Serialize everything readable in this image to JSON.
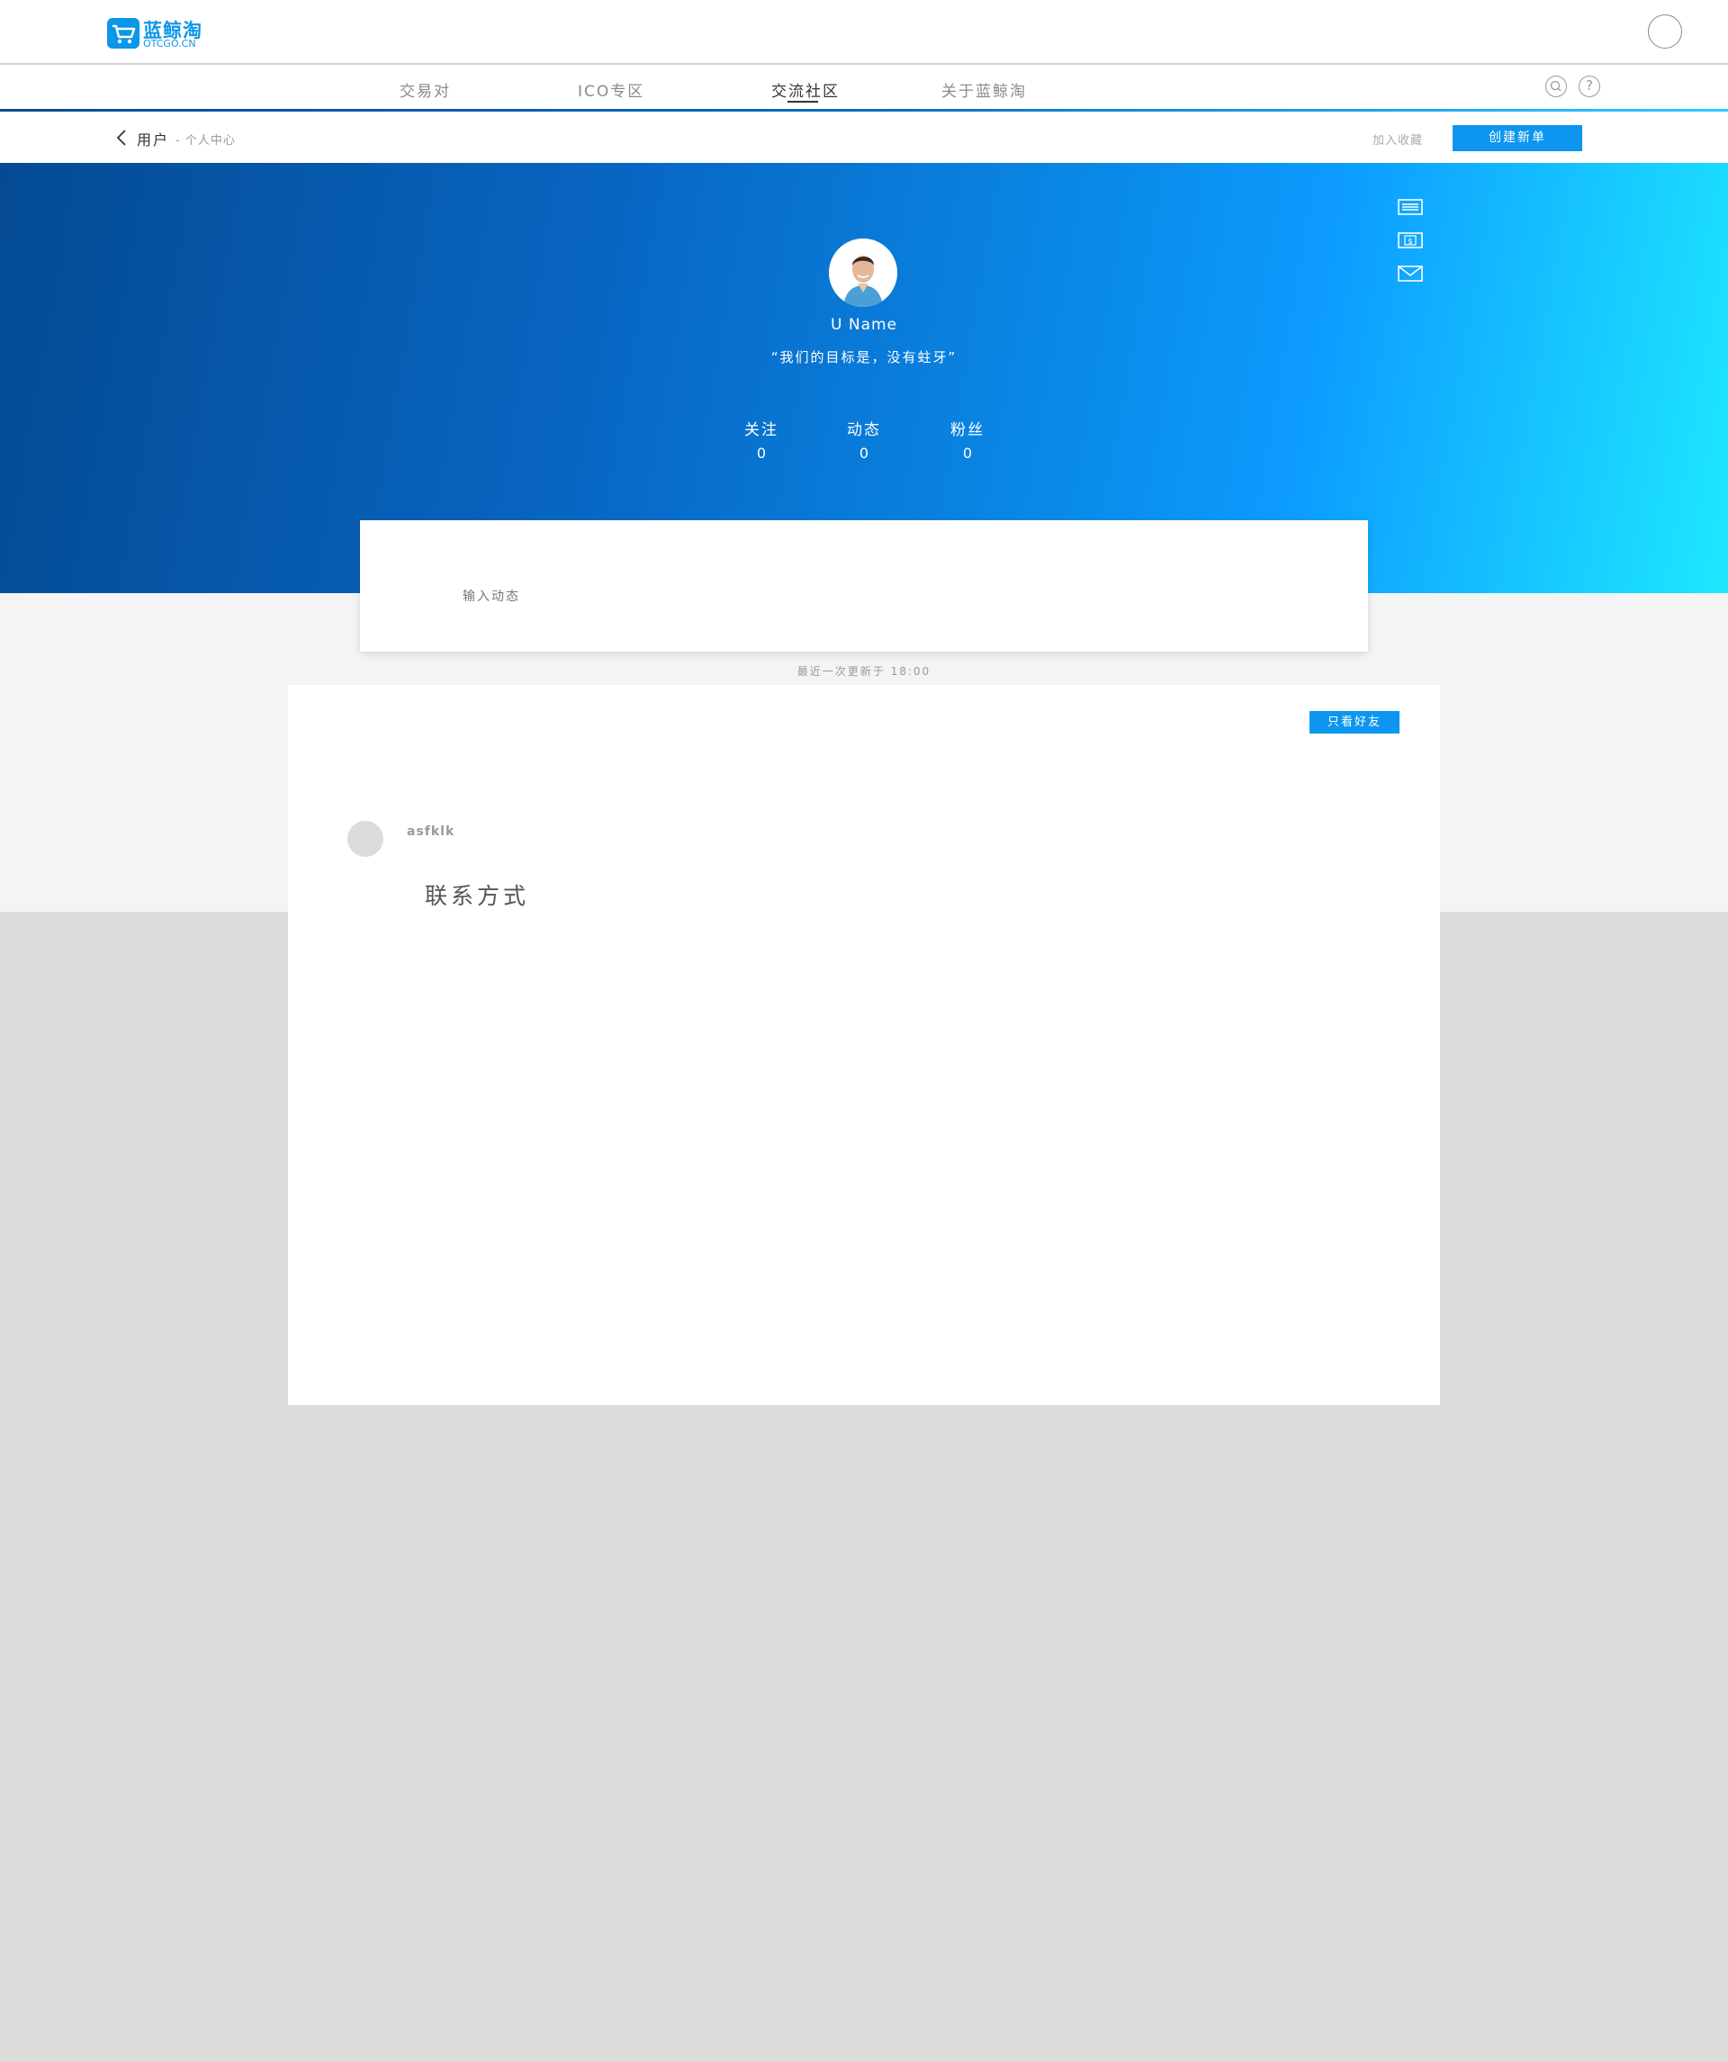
{
  "header": {
    "logo_cn": "蓝鲸淘",
    "logo_en": "OTCGO.CN",
    "logo_icon": "shopping-cart-icon",
    "user_icon": "user-avatar-circle"
  },
  "nav": {
    "items": [
      {
        "label": "交易对",
        "active": false
      },
      {
        "label": "ICO专区",
        "active": false
      },
      {
        "label": "交流社区",
        "active": true
      },
      {
        "label": "关于蓝鲸淘",
        "active": false
      }
    ],
    "help_glyph": "?",
    "icons": [
      "search-icon",
      "help-icon"
    ]
  },
  "breadcrumb": {
    "title": "用户",
    "subtitle": "- 个人中心",
    "favorite_label": "加入收藏",
    "create_label": "创建新单",
    "back_icon": "chevron-left-icon"
  },
  "profile": {
    "username": "U Name",
    "motto": "“我们的目标是，没有蛀牙”",
    "stats": [
      {
        "label": "关注",
        "value": "0"
      },
      {
        "label": "动态",
        "value": "0"
      },
      {
        "label": "粉丝",
        "value": "0"
      }
    ],
    "side_icons": [
      "list-icon",
      "dollar-bill-icon",
      "mail-icon"
    ]
  },
  "composer": {
    "placeholder": "输入动态",
    "last_update": "最近一次更新于 18:00"
  },
  "feed": {
    "filter_label": "只看好友",
    "posts": [
      {
        "author": "asfklk",
        "content": "联系方式"
      }
    ]
  },
  "colors": {
    "accent": "#0c96f0",
    "banner_start": "#044a93",
    "banner_end": "#1ee8ff",
    "page_bg": "#dcdcdb",
    "band_bg": "#f4f4f4"
  }
}
